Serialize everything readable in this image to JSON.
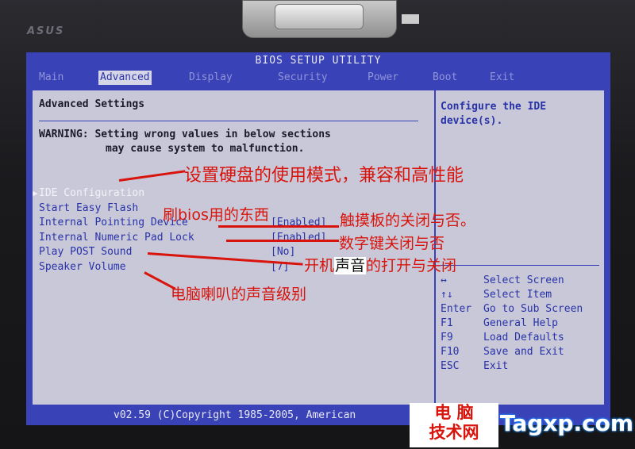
{
  "bios": {
    "title": "BIOS SETUP UTILITY",
    "menu": [
      {
        "label": "Main",
        "active": false
      },
      {
        "label": "Advanced",
        "active": true
      },
      {
        "label": "Display",
        "active": false
      },
      {
        "label": "Security",
        "active": false
      },
      {
        "label": "Power",
        "active": false
      },
      {
        "label": "Boot",
        "active": false
      },
      {
        "label": "Exit",
        "active": false
      }
    ],
    "pane_title": "Advanced Settings",
    "warning_line1": "WARNING: Setting wrong values in below sections",
    "warning_line2": "may cause system to malfunction.",
    "settings": [
      {
        "label": "IDE Configuration",
        "value": "",
        "selected": true
      },
      {
        "label": "Start Easy Flash",
        "value": ""
      },
      {
        "label": "Internal Pointing Device",
        "value": "[Enabled]"
      },
      {
        "label": "Internal Numeric Pad Lock",
        "value": "[Enabled]"
      },
      {
        "label": "Play POST Sound",
        "value": "[No]"
      },
      {
        "label": "Speaker Volume",
        "value": "[7]"
      }
    ],
    "help_text": "Configure the IDE device(s).",
    "keys": [
      {
        "key": "↔",
        "action": "Select Screen"
      },
      {
        "key": "↑↓",
        "action": "Select Item"
      },
      {
        "key": "Enter",
        "action": "Go to Sub Screen"
      },
      {
        "key": "F1",
        "action": "General Help"
      },
      {
        "key": "F9",
        "action": "Load Defaults"
      },
      {
        "key": "F10",
        "action": "Save and Exit"
      },
      {
        "key": "ESC",
        "action": "Exit"
      }
    ],
    "footer": "v02.59 (C)Copyright 1985-2005, American"
  },
  "bezel": {
    "brand": "ASUS"
  },
  "annotations": {
    "ide": "设置硬盘的使用模式，兼容和高性能",
    "flash": "刷bios用的东西",
    "pointing": "触摸板的关闭与否。",
    "numpad": "数字键关闭与否",
    "sound_pre": "开机",
    "sound_hl": "声音",
    "sound_post": "的打开与关闭",
    "speaker": "电脑喇叭的声音级别"
  },
  "watermark": {
    "line1": "电 脑",
    "line2": "技术网",
    "site": "Tagxp.com"
  },
  "colors": {
    "bios_blue": "#3a42b8",
    "panel_gray": "#c8c8d8",
    "annotation_red": "#d8140c"
  }
}
